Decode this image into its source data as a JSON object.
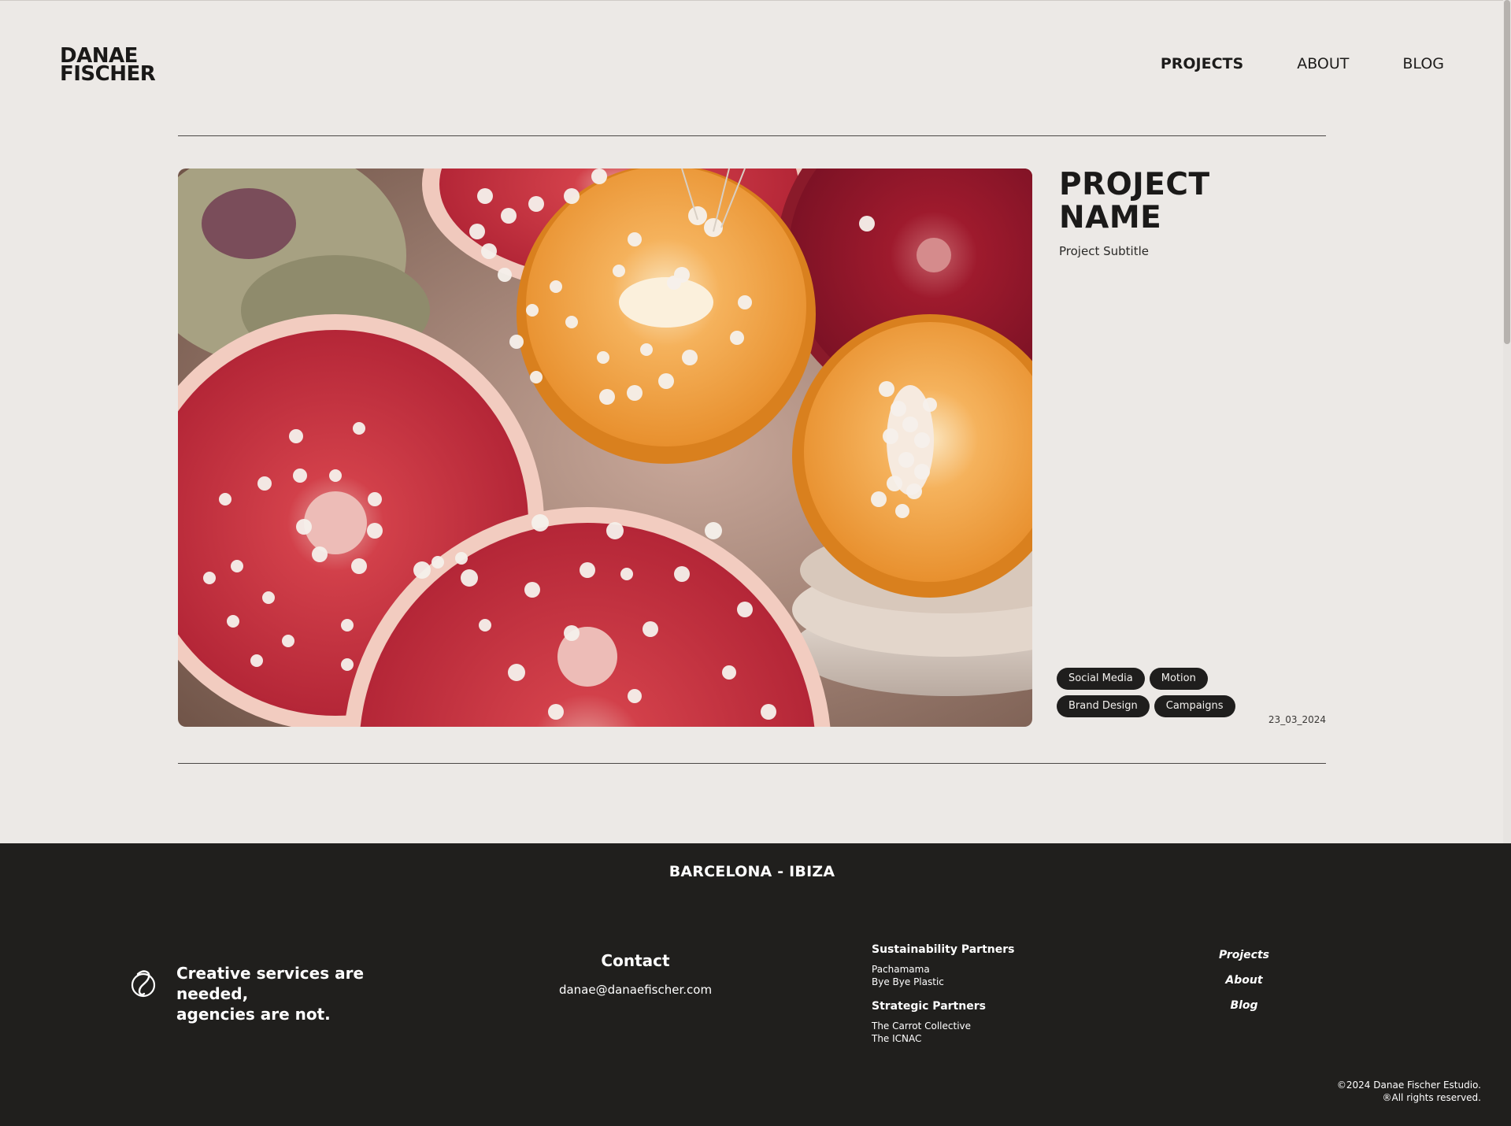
{
  "brand": {
    "line1": "DANAE",
    "line2": "FISCHER"
  },
  "nav": [
    {
      "label": "PROJECTS",
      "active": true
    },
    {
      "label": "ABOUT",
      "active": false
    },
    {
      "label": "BLOG",
      "active": false
    }
  ],
  "project": {
    "title_line1": "PROJECT",
    "title_line2": "NAME",
    "subtitle": "Project Subtitle",
    "tags": [
      "Social Media",
      "Motion",
      "Brand Design",
      "Campaigns"
    ],
    "date": "23_03_2024",
    "image_icon": "hero-image"
  },
  "footer": {
    "location": "BARCELONA - IBIZA",
    "mark_icon": "script-d-logo-icon",
    "tagline_line1": "Creative services are needed,",
    "tagline_line2": "agencies are not.",
    "contact_heading": "Contact",
    "email": "danae@danaefischer.com",
    "sustainability_heading": "Sustainability Partners",
    "sustainability_partners": [
      "Pachamama",
      "Bye Bye Plastic"
    ],
    "strategic_heading": "Strategic Partners",
    "strategic_partners": [
      "The Carrot Collective",
      "The ICNAC"
    ],
    "links": [
      "Projects",
      "About",
      "Blog"
    ],
    "copyright_line1": "©2024 Danae Fischer Estudio.",
    "copyright_line2": "®All rights reserved."
  },
  "colors": {
    "page_bg": "#ece9e6",
    "footer_bg": "#201f1d",
    "ink": "#1d1c1b",
    "tag_bg": "#1f1e1d"
  }
}
